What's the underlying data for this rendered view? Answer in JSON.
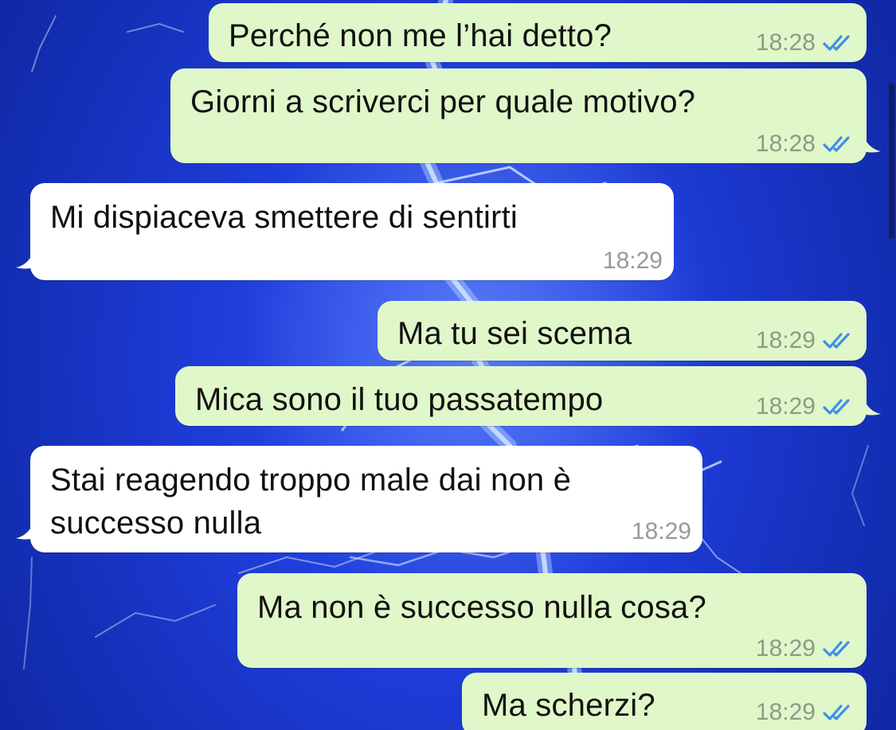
{
  "conversation": {
    "messages": [
      {
        "direction": "outgoing",
        "text": "Perché non me l’hai detto?",
        "time": "18:28",
        "status": "read"
      },
      {
        "direction": "outgoing",
        "text": "Giorni a scriverci per quale motivo?",
        "time": "18:28",
        "status": "read"
      },
      {
        "direction": "incoming",
        "text": "Mi dispiaceva smettere di sentirti",
        "time": "18:29"
      },
      {
        "direction": "outgoing",
        "text": "Ma tu sei scema",
        "time": "18:29",
        "status": "read"
      },
      {
        "direction": "outgoing",
        "text": "Mica sono il tuo passatempo",
        "time": "18:29",
        "status": "read"
      },
      {
        "direction": "incoming",
        "text_lines": [
          "Stai reagendo troppo male dai non è",
          "successo nulla"
        ],
        "time": "18:29"
      },
      {
        "direction": "outgoing",
        "text": "Ma non è successo nulla cosa?",
        "time": "18:29",
        "status": "read"
      },
      {
        "direction": "outgoing",
        "text": "Ma scherzi?",
        "time": "18:29",
        "status": "read"
      }
    ]
  },
  "icons": {
    "read_receipt": "double-check-icon",
    "wallpaper": "lightning-wallpaper"
  },
  "colors": {
    "outgoing_bubble": "#e0f7c9",
    "incoming_bubble": "#ffffff",
    "read_tick": "#3f8fe6",
    "wallpaper": "#1c39c8"
  }
}
